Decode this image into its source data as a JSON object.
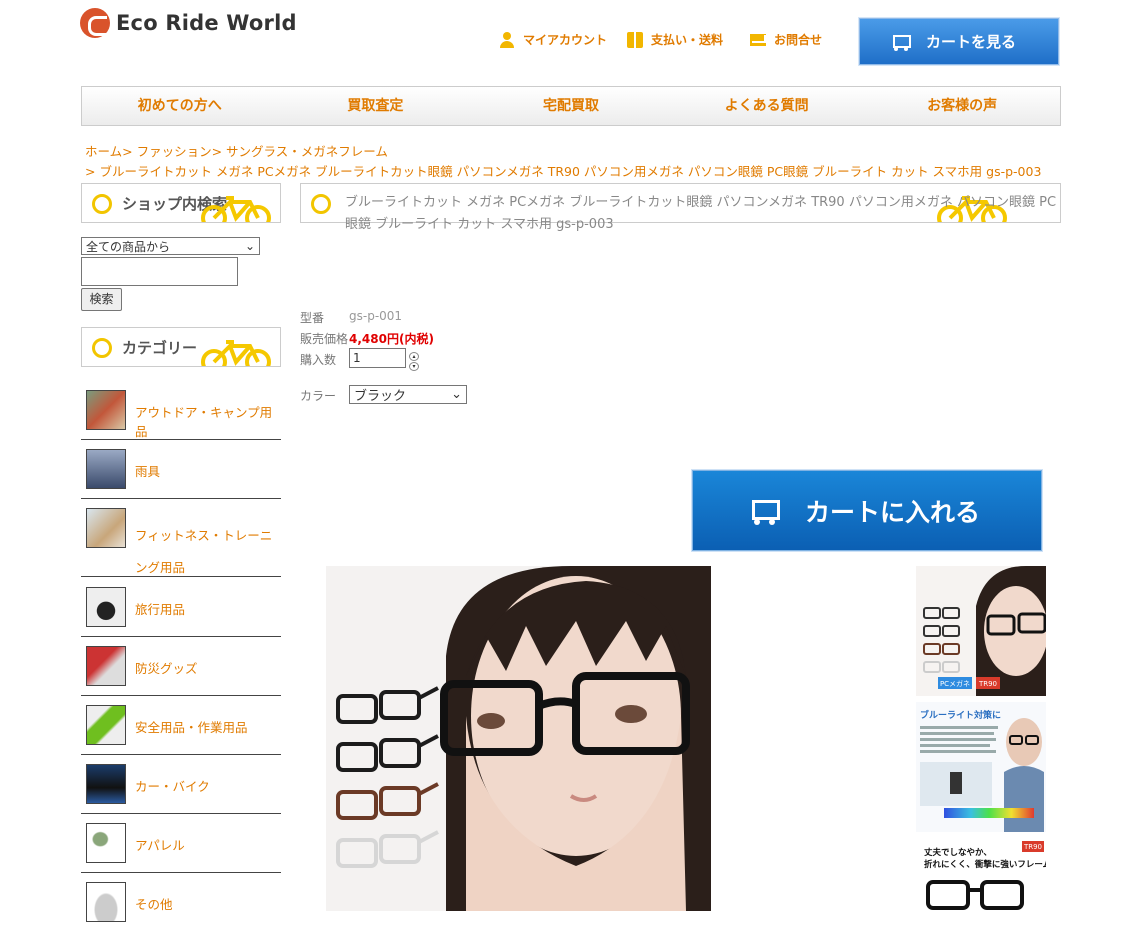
{
  "header": {
    "logo_text": "Eco Ride World",
    "links": [
      {
        "label": "マイアカウント",
        "icon": "user-icon"
      },
      {
        "label": "支払い・送料",
        "icon": "gift-icon"
      },
      {
        "label": "お問合せ",
        "icon": "mail-icon"
      }
    ],
    "cart_button": "カートを見る"
  },
  "nav": [
    "初めての方へ",
    "買取査定",
    "宅配買取",
    "よくある質問",
    "お客様の声"
  ],
  "breadcrumb": {
    "line1": "ホーム>  ファッション>  サングラス・メガネフレーム",
    "line2": "> ブルーライトカット メガネ PCメガネ ブルーライトカット眼鏡 パソコンメガネ TR90 パソコン用メガネ パソコン眼鏡 PC眼鏡 ブルーライト カット スマホ用 gs-p-003"
  },
  "sidebar": {
    "search_title": "ショップ内検索",
    "search_select": "全ての商品から",
    "search_input": "",
    "search_button": "検索",
    "category_title": "カテゴリー",
    "categories": [
      {
        "label": "アウトドア・キャンプ用品"
      },
      {
        "label": "雨具"
      },
      {
        "label": "フィットネス・トレーニング用品"
      },
      {
        "label": "旅行用品"
      },
      {
        "label": "防災グッズ"
      },
      {
        "label": "安全用品・作業用品"
      },
      {
        "label": "カー・バイク"
      },
      {
        "label": "アパレル"
      },
      {
        "label": "その他"
      }
    ]
  },
  "product": {
    "title": "ブルーライトカット メガネ PCメガネ ブルーライトカット眼鏡 パソコンメガネ TR90 パソコン用メガネ パソコン眼鏡 PC眼鏡 ブルーライト カット スマホ用 gs-p-003",
    "model_label": "型番",
    "model_value": "gs-p-001",
    "price_label": "販売価格",
    "price_value": "4,480円(内税)",
    "qty_label": "購入数",
    "qty_value": "1",
    "color_label": "カラー",
    "color_value": "ブラック",
    "add_to_cart": "カートに入れる",
    "thumb_texts": {
      "t1_badges": [
        "PCメガネ",
        "TR90"
      ],
      "t2_heading": "ブルーライト対策に",
      "t3_heading": "丈夫でしなやか、折れにくく、衝撃に強いフレーム",
      "t3_badge": "TR90"
    }
  }
}
